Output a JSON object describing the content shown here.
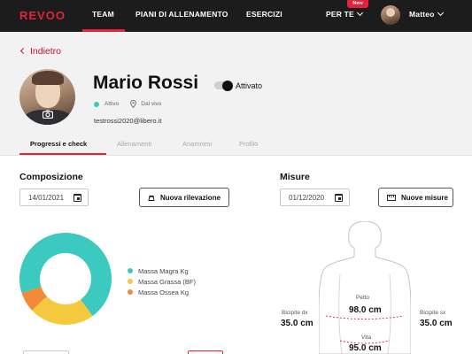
{
  "nav": {
    "logo": "REVOO",
    "items": [
      "TEAM",
      "PIANI DI ALLENAMENTO",
      "ESERCIZI"
    ],
    "per_te": "PER TE",
    "new_badge": "New",
    "user_name": "Matteo",
    "accent_color": "#e4233a"
  },
  "back_label": "Indietro",
  "profile": {
    "name": "Mario Rossi",
    "toggle_label": "Attivato",
    "status_active": "Attivo",
    "status_location": "Dal vivo",
    "email": "testrossi2020@libero.it"
  },
  "tabs": [
    "Progressi e check",
    "Allenamenti",
    "Anamnesi",
    "Profilo"
  ],
  "composizione": {
    "title": "Composizione",
    "date": "14/01/2021",
    "button": "Nuova rilevazione"
  },
  "misure": {
    "title": "Misure",
    "date": "01/12/2020",
    "button": "Nuove misure"
  },
  "chart_data": {
    "type": "pie",
    "categories": [
      "Massa Magra Kg",
      "Massa Grassa (BF)",
      "Massa Ossea Kg"
    ],
    "values": [
      70,
      23,
      7
    ],
    "colors": [
      "#3cc9c0",
      "#f5c93e",
      "#f28a3a"
    ],
    "title": "",
    "donut": true
  },
  "measurements": {
    "petto_label": "Petto",
    "petto_value": "98.0 cm",
    "bicipite_dx_label": "Bicipite dx",
    "bicipite_dx_value": "35.0 cm",
    "bicipite_sx_label": "Bicipite sx",
    "bicipite_sx_value": "35.0 cm",
    "vita_label": "Vita",
    "vita_value": "95.0 cm"
  }
}
